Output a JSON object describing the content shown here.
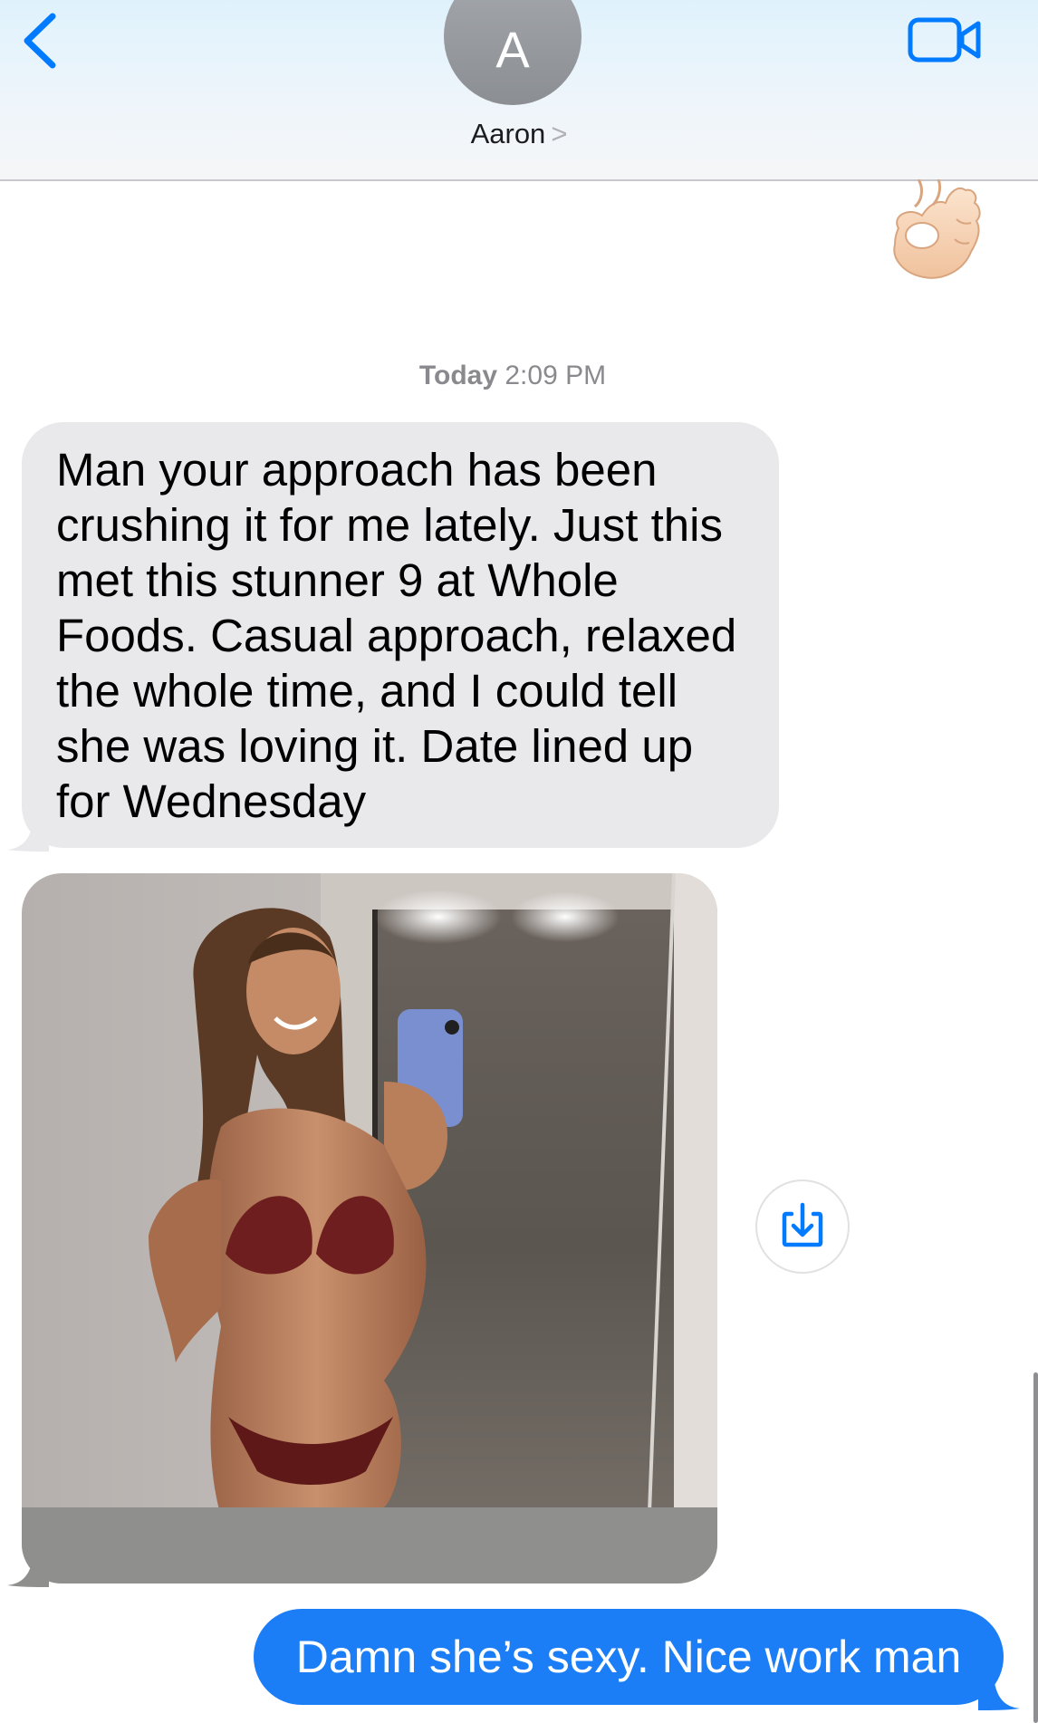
{
  "header": {
    "avatar_initial": "A",
    "contact_name": "Aaron",
    "chevron": ">"
  },
  "icons": {
    "back": "chevron-left-icon",
    "video": "video-camera-icon",
    "save": "download-icon",
    "emoji": "ok-hand-emoji"
  },
  "colors": {
    "accent": "#007aff",
    "outgoing_bubble": "#1b7ef7",
    "incoming_bubble": "#e9e9eb"
  },
  "thread": {
    "timestamp_day": "Today",
    "timestamp_time": "2:09 PM",
    "messages": [
      {
        "direction": "incoming",
        "text": "Man your approach has been crushing it for me lately. Just this met this stunner 9 at Whole Foods. Casual approach, relaxed the whole time, and I could tell she was loving it. Date lined up for Wednesday"
      },
      {
        "direction": "outgoing",
        "text": "Damn she’s sexy. Nice work man"
      }
    ]
  }
}
